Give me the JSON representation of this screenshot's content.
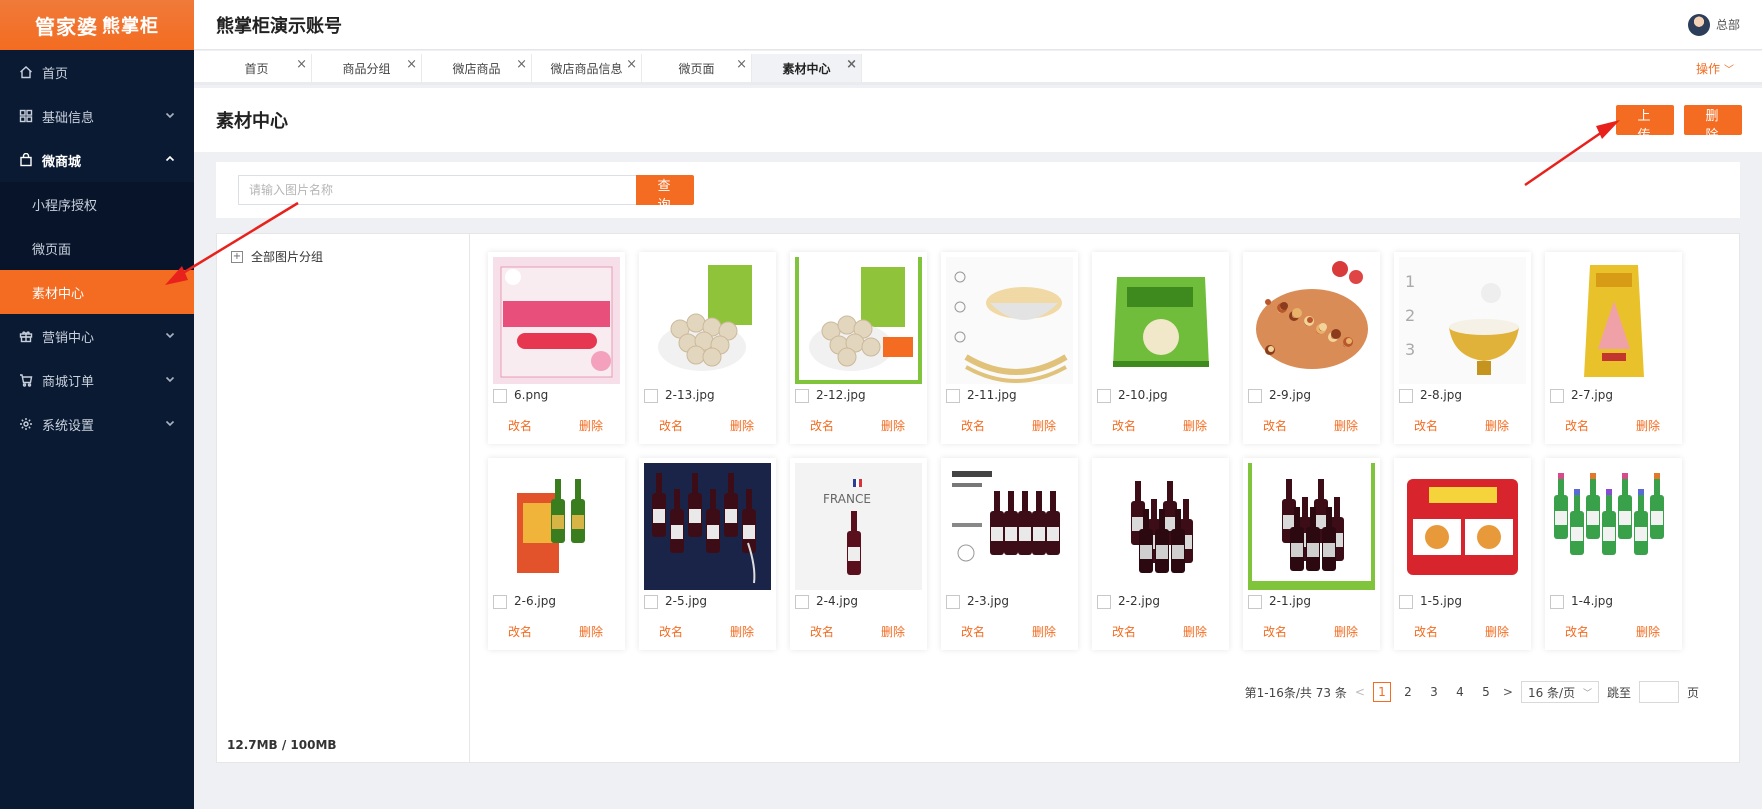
{
  "brand": {
    "logo_main": "管家婆",
    "logo_sub": "熊掌柜"
  },
  "header": {
    "account_title": "熊掌柜演示账号",
    "user_name": "总部"
  },
  "sidebar": {
    "items": [
      {
        "label": "首页",
        "icon": "home-icon"
      },
      {
        "label": "基础信息",
        "icon": "grid-icon"
      },
      {
        "label": "微商城",
        "icon": "shopping-bag-icon",
        "children": [
          "小程序授权",
          "微页面",
          "素材中心"
        ]
      },
      {
        "label": "营销中心",
        "icon": "gift-icon"
      },
      {
        "label": "商城订单",
        "icon": "cart-icon"
      },
      {
        "label": "系统设置",
        "icon": "gear-icon"
      }
    ]
  },
  "tabs": [
    {
      "label": "首页"
    },
    {
      "label": "商品分组"
    },
    {
      "label": "微店商品"
    },
    {
      "label": "微店商品信息"
    },
    {
      "label": "微页面"
    },
    {
      "label": "素材中心"
    }
  ],
  "tabs_ops_label": "操作",
  "page": {
    "title": "素材中心",
    "upload_label": "上传",
    "delete_label": "删除"
  },
  "search": {
    "placeholder": "请输入图片名称",
    "value": "",
    "button_label": "查询"
  },
  "groups": {
    "root_label": "全部图片分组",
    "storage": "12.7MB / 100MB"
  },
  "card_actions": {
    "rename": "改名",
    "delete": "删除"
  },
  "images": [
    {
      "name": "6.png",
      "thumb": "spring-promo"
    },
    {
      "name": "2-13.jpg",
      "thumb": "quail-eggs"
    },
    {
      "name": "2-12.jpg",
      "thumb": "quail-eggs-green"
    },
    {
      "name": "2-11.jpg",
      "thumb": "noodles"
    },
    {
      "name": "2-10.jpg",
      "thumb": "green-snack"
    },
    {
      "name": "2-9.jpg",
      "thumb": "granola"
    },
    {
      "name": "2-8.jpg",
      "thumb": "rice-bowl"
    },
    {
      "name": "2-7.jpg",
      "thumb": "rice-bag"
    },
    {
      "name": "2-6.jpg",
      "thumb": "olive-oil"
    },
    {
      "name": "2-5.jpg",
      "thumb": "wine-dark"
    },
    {
      "name": "2-4.jpg",
      "thumb": "wine-france"
    },
    {
      "name": "2-3.jpg",
      "thumb": "wine-six"
    },
    {
      "name": "2-2.jpg",
      "thumb": "wine-group"
    },
    {
      "name": "2-1.jpg",
      "thumb": "wine-green"
    },
    {
      "name": "1-5.jpg",
      "thumb": "cereal"
    },
    {
      "name": "1-4.jpg",
      "thumb": "soju"
    }
  ],
  "pagination": {
    "summary": "第1-16条/共 73 条",
    "pages": [
      "1",
      "2",
      "3",
      "4",
      "5"
    ],
    "current": "1",
    "page_size": "16 条/页",
    "jump_label": "跳至",
    "jump_suffix": "页"
  },
  "colors": {
    "accent": "#f36c21",
    "sidebar_bg": "#0b1a33",
    "annotation": "#e8211c"
  }
}
